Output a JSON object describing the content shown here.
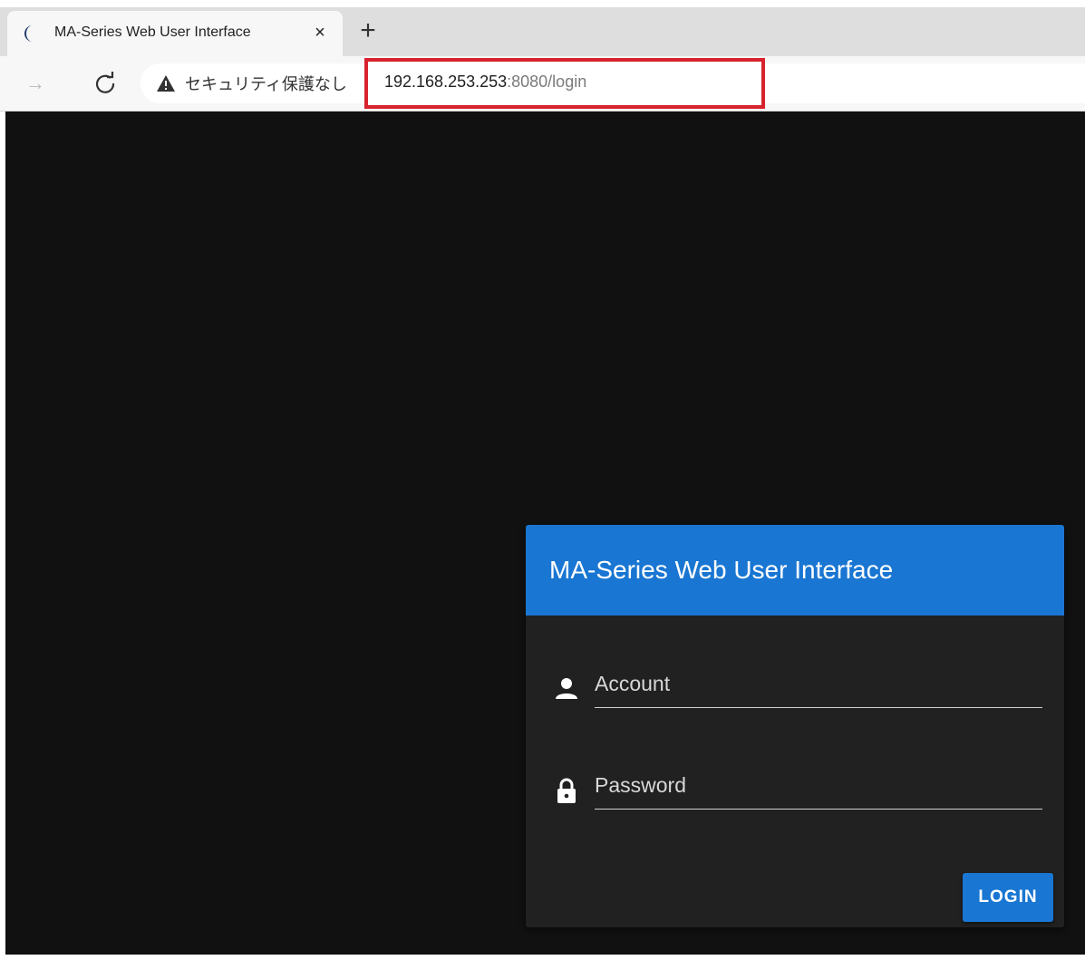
{
  "browser": {
    "tab_title": "MA-Series Web User Interface",
    "tab_close_label": "×",
    "new_tab_label": "+",
    "forward_label": "→",
    "security_label": "セキュリティ保護なし",
    "url_host": "192.168.253.253",
    "url_rest": ":8080/login",
    "highlight_color": "#d7232e"
  },
  "icons": {
    "favicon": "crescent-moon-icon",
    "reload": "reload-icon",
    "warning": "warning-triangle-icon",
    "account": "person-icon",
    "password": "lock-icon"
  },
  "login": {
    "title": "MA-Series Web User Interface",
    "account_placeholder": "Account",
    "password_placeholder": "Password",
    "login_label": "LOGIN",
    "accent_color": "#1976d2",
    "page_background": "#111111",
    "card_background": "#212121"
  }
}
